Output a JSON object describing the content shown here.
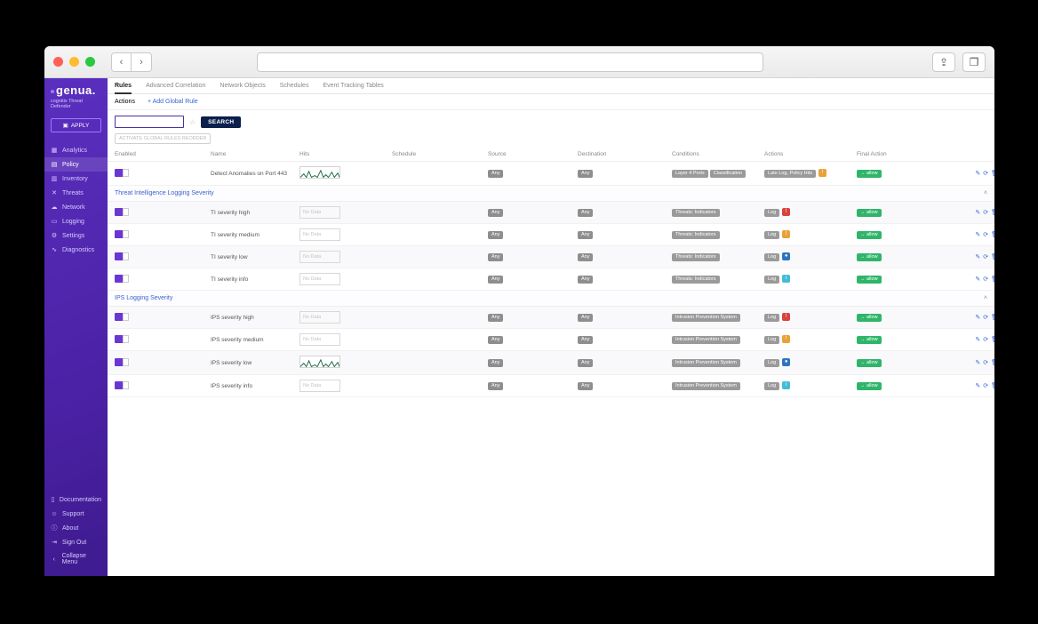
{
  "brand": {
    "name": "genua.",
    "subtitle": "cognitix Threat Defender",
    "apply": "APPLY"
  },
  "sidebar": {
    "items": [
      {
        "icon": "▦",
        "label": "Analytics"
      },
      {
        "icon": "▤",
        "label": "Policy"
      },
      {
        "icon": "▥",
        "label": "Inventory"
      },
      {
        "icon": "✕",
        "label": "Threats"
      },
      {
        "icon": "☁",
        "label": "Network"
      },
      {
        "icon": "▭",
        "label": "Logging"
      },
      {
        "icon": "⚙",
        "label": "Settings"
      },
      {
        "icon": "∿",
        "label": "Diagnostics"
      }
    ],
    "bottom": [
      {
        "icon": "▯",
        "label": "Documentation"
      },
      {
        "icon": "☺",
        "label": "Support"
      },
      {
        "icon": "ⓘ",
        "label": "About"
      },
      {
        "icon": "⇥",
        "label": "Sign Out"
      },
      {
        "icon": "‹",
        "label": "Collapse Menu"
      }
    ]
  },
  "tabs": [
    "Rules",
    "Advanced Correlation",
    "Network Objects",
    "Schedules",
    "Event Tracking Tables"
  ],
  "actionsbar": {
    "actions": "Actions",
    "addGlobal": "+ Add Global Rule"
  },
  "toolbar": {
    "searchPlaceholder": "",
    "searchBtn": "SEARCH",
    "reorder": "ACTIVATE GLOBAL RULES REORDER"
  },
  "columns": [
    "Enabled",
    "Name",
    "Hits",
    "Schedule",
    "Source",
    "Destination",
    "Conditions",
    "Actions",
    "Final Action",
    ""
  ],
  "pillLabels": {
    "any": "Any",
    "nodata": "No Data",
    "finalAllow": "→ allow",
    "log": "Log"
  },
  "groups": [
    {
      "title": "",
      "rows": [
        {
          "enabled": true,
          "name": "Detect Anomalies on Port 443",
          "hits": "spark",
          "source": "Any",
          "dest": "Any",
          "conditions": [
            "Layer 4 Ports",
            "Classification"
          ],
          "actions": [
            "Late Log, Policy Hits"
          ],
          "severity": "m",
          "final": "→ allow"
        }
      ]
    },
    {
      "title": "Threat Intelligence Logging Severity",
      "rows": [
        {
          "enabled": true,
          "name": "TI severity high",
          "hits": "nodata",
          "source": "Any",
          "dest": "Any",
          "conditions": [
            "Threats: Indicators"
          ],
          "actions": [
            "Log"
          ],
          "severity": "h",
          "final": "→ allow"
        },
        {
          "enabled": true,
          "name": "TI severity medium",
          "hits": "nodata",
          "source": "Any",
          "dest": "Any",
          "conditions": [
            "Threats: Indicators"
          ],
          "actions": [
            "Log"
          ],
          "severity": "m",
          "final": "→ allow"
        },
        {
          "enabled": true,
          "name": "TI severity low",
          "hits": "nodata",
          "source": "Any",
          "dest": "Any",
          "conditions": [
            "Threats: Indicators"
          ],
          "actions": [
            "Log"
          ],
          "severity": "l",
          "final": "→ allow"
        },
        {
          "enabled": true,
          "name": "TI severity info",
          "hits": "nodata",
          "source": "Any",
          "dest": "Any",
          "conditions": [
            "Threats: Indicators"
          ],
          "actions": [
            "Log"
          ],
          "severity": "i",
          "final": "→ allow"
        }
      ]
    },
    {
      "title": "IPS Logging Severity",
      "rows": [
        {
          "enabled": true,
          "name": "IPS severity high",
          "hits": "nodata",
          "source": "Any",
          "dest": "Any",
          "conditions": [
            "Intrusion Prevention System"
          ],
          "actions": [
            "Log"
          ],
          "severity": "h",
          "final": "→ allow"
        },
        {
          "enabled": true,
          "name": "IPS severity medium",
          "hits": "nodata",
          "source": "Any",
          "dest": "Any",
          "conditions": [
            "Intrusion Prevention System"
          ],
          "actions": [
            "Log"
          ],
          "severity": "m",
          "final": "→ allow"
        },
        {
          "enabled": true,
          "name": "IPS severity low",
          "hits": "spark",
          "source": "Any",
          "dest": "Any",
          "conditions": [
            "Intrusion Prevention System"
          ],
          "actions": [
            "Log"
          ],
          "severity": "l",
          "final": "→ allow"
        },
        {
          "enabled": true,
          "name": "IPS severity info",
          "hits": "nodata",
          "source": "Any",
          "dest": "Any",
          "conditions": [
            "Intrusion Prevention System"
          ],
          "actions": [
            "Log"
          ],
          "severity": "i",
          "final": "→ allow"
        }
      ]
    }
  ]
}
